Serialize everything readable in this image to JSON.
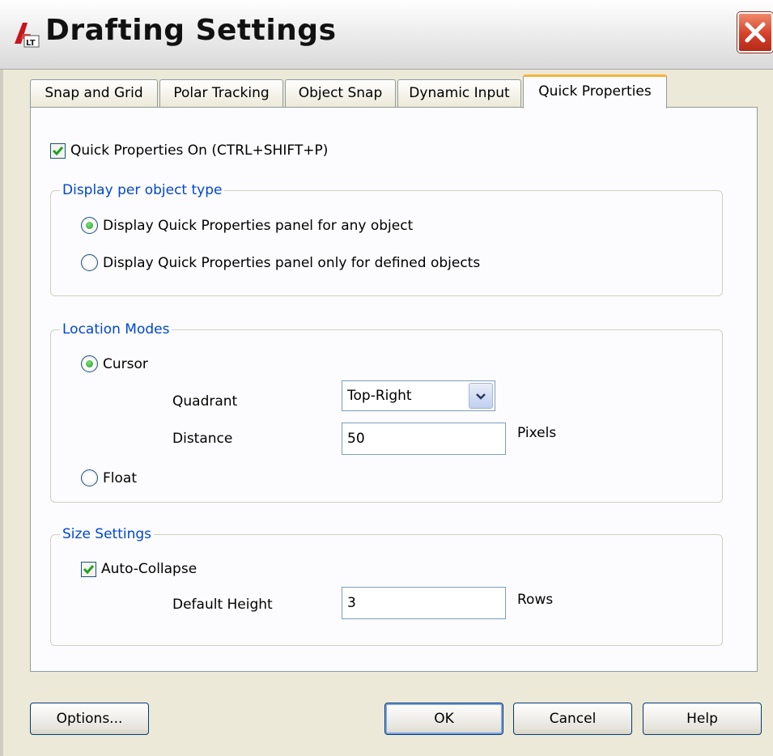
{
  "window": {
    "title": "Drafting Settings",
    "app_icon": "autocad-lt-icon",
    "close_icon": "close-icon"
  },
  "tabs": [
    {
      "label": "Snap and Grid",
      "active": false
    },
    {
      "label": "Polar Tracking",
      "active": false
    },
    {
      "label": "Object Snap",
      "active": false
    },
    {
      "label": "Dynamic Input",
      "active": false
    },
    {
      "label": "Quick Properties",
      "active": true
    }
  ],
  "quick_properties": {
    "enable_label": "Quick Properties On (CTRL+SHIFT+P)",
    "enable_checked": true,
    "display_group": {
      "legend": "Display per object type",
      "options": [
        {
          "label": "Display Quick Properties panel for any object",
          "selected": true
        },
        {
          "label": "Display Quick Properties panel only for defined objects",
          "selected": false
        }
      ]
    },
    "location_group": {
      "legend": "Location Modes",
      "cursor_label": "Cursor",
      "cursor_selected": true,
      "quadrant_label": "Quadrant",
      "quadrant_value": "Top-Right",
      "distance_label": "Distance",
      "distance_value": "50",
      "distance_unit": "Pixels",
      "float_label": "Float",
      "float_selected": false
    },
    "size_group": {
      "legend": "Size Settings",
      "auto_collapse_label": "Auto-Collapse",
      "auto_collapse_checked": true,
      "default_height_label": "Default Height",
      "default_height_value": "3",
      "default_height_unit": "Rows"
    }
  },
  "buttons": {
    "options": "Options...",
    "ok": "OK",
    "cancel": "Cancel",
    "help": "Help"
  },
  "colors": {
    "accent_tab": "#f7b23b",
    "legend_text": "#0046d5",
    "check_green": "#21a121",
    "close_red": "#d5402a"
  }
}
